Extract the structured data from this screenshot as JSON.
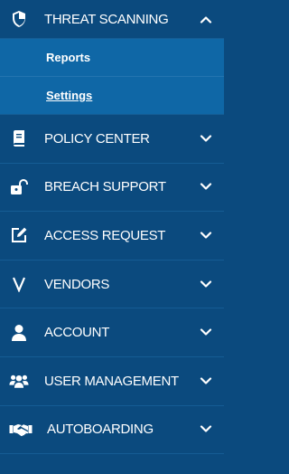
{
  "menu": {
    "threat_scanning": {
      "label": "THREAT SCANNING",
      "icon": "shield-icon",
      "expanded": true,
      "submenu": [
        {
          "label": "Reports",
          "active": false
        },
        {
          "label": "Settings",
          "active": true
        }
      ]
    },
    "items": [
      {
        "label": "POLICY CENTER",
        "icon": "book-icon"
      },
      {
        "label": "BREACH SUPPORT",
        "icon": "unlock-icon"
      },
      {
        "label": "ACCESS REQUEST",
        "icon": "edit-icon"
      },
      {
        "label": "VENDORS",
        "icon": "vendors-v-icon"
      },
      {
        "label": "ACCOUNT",
        "icon": "user-icon"
      },
      {
        "label": "USER MANAGEMENT",
        "icon": "users-icon"
      },
      {
        "label": "AUTOBOARDING",
        "icon": "handshake-icon"
      }
    ]
  },
  "colors": {
    "sidebar_bg": "#0b4a7e",
    "submenu_bg": "#0f67a6",
    "text": "#ffffff",
    "divider": "#155c94"
  }
}
